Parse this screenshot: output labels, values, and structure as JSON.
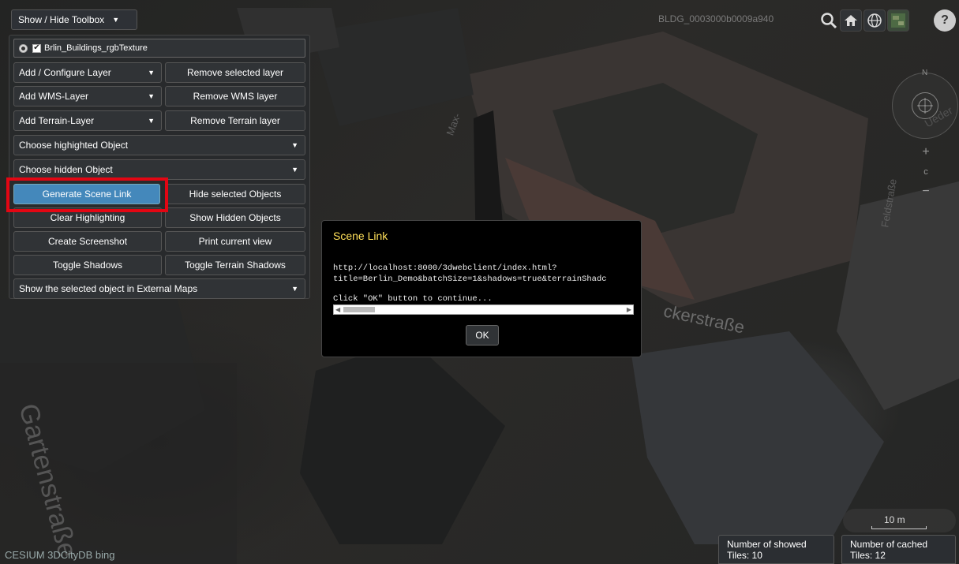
{
  "toolbox": {
    "toggle_label": "Show / Hide Toolbox",
    "layer_name": "Brlin_Buildings_rgbTexture",
    "buttons": {
      "add_configure_layer": "Add / Configure Layer",
      "remove_selected_layer": "Remove selected layer",
      "add_wms_layer": "Add WMS-Layer",
      "remove_wms_layer": "Remove WMS layer",
      "add_terrain_layer": "Add Terrain-Layer",
      "remove_terrain_layer": "Remove Terrain layer",
      "choose_highlighted_object": "Choose highighted Object",
      "choose_hidden_object": "Choose hidden Object",
      "generate_scene_link": "Generate Scene Link",
      "hide_selected_objects": "Hide selected Objects",
      "clear_highlighting": "Clear Highlighting",
      "show_hidden_objects": "Show Hidden Objects",
      "create_screenshot": "Create Screenshot",
      "print_current_view": "Print current view",
      "toggle_shadows": "Toggle Shadows",
      "toggle_terrain_shadows": "Toggle Terrain Shadows",
      "show_in_external_maps": "Show the selected object in External Maps"
    }
  },
  "header": {
    "object_id": "BLDG_0003000b0009a940"
  },
  "icons": {
    "search": "search-icon",
    "home": "home-icon",
    "globe": "globe-icon",
    "layers": "imagery-layers-icon",
    "help": "help-icon"
  },
  "navigation": {
    "north_label": "N",
    "zoom_in": "+",
    "reset": "c",
    "zoom_out": "−"
  },
  "map": {
    "street_labels": {
      "max": "Max-",
      "ueder": "Ueder",
      "feldstrasse": "Feldstraße",
      "ackerstrasse": "ckerstraße",
      "gartenstrasse": "Gartenstraße"
    }
  },
  "dialog": {
    "title": "Scene Link",
    "url_line1": "http://localhost:8000/3dwebclient/index.html?",
    "url_line2": "title=Berlin_Demo&batchSize=1&shadows=true&terrainShadc",
    "instruction": "Click \"OK\" button to continue...",
    "ok_label": "OK"
  },
  "status": {
    "scale": "10 m",
    "showed_tiles_line1": "Number of showed",
    "showed_tiles_line2": "Tiles: 10",
    "cached_tiles_line1": "Number of cached",
    "cached_tiles_line2": "Tiles: 12",
    "credits": "CESIUM  3DCityDB  bing"
  },
  "colors": {
    "highlight_frame": "#e30613",
    "dialog_title": "#ffe05a",
    "active_button": "#4488bb"
  }
}
